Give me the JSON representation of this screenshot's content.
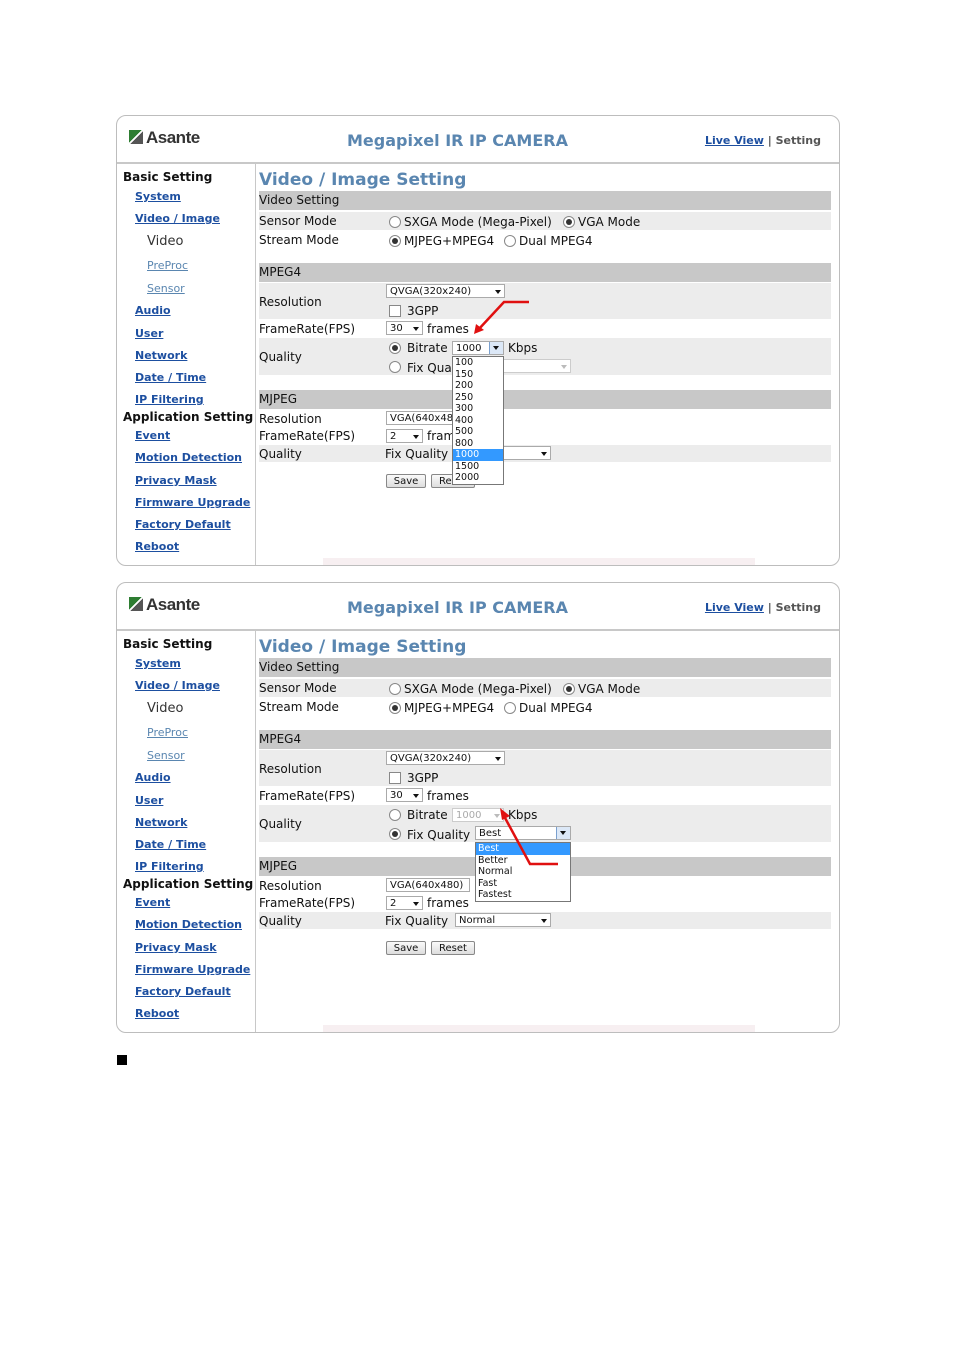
{
  "header": {
    "logo_text": "Asante",
    "camera_title": "Megapixel IR IP CAMERA",
    "live_view_link": "Live View",
    "separator": "|",
    "setting_label": "Setting"
  },
  "sidebar": {
    "basic_heading": "Basic Setting",
    "system": "System",
    "video_image": "Video / Image",
    "video": "Video",
    "preproc": "PreProc",
    "sensor": "Sensor",
    "audio": "Audio",
    "user": "User",
    "network": "Network",
    "date_time": "Date / Time",
    "ip_filtering": "IP Filtering",
    "app_heading": "Application Setting",
    "event": "Event",
    "motion_detection": "Motion Detection",
    "privacy_mask": "Privacy Mask",
    "firmware_upgrade": "Firmware Upgrade",
    "factory_default": "Factory Default",
    "reboot": "Reboot"
  },
  "page": {
    "title": "Video / Image Setting",
    "video_setting": "Video Setting",
    "sensor_mode_label": "Sensor Mode",
    "sensor_opt1": "SXGA Mode (Mega-Pixel)",
    "sensor_opt2": "VGA Mode",
    "stream_mode_label": "Stream Mode",
    "stream_opt1": "MJPEG+MPEG4",
    "stream_opt2": "Dual MPEG4",
    "mpeg4": "MPEG4",
    "resolution_label": "Resolution",
    "mpeg4_resolution": "QVGA(320x240)",
    "gpp_label": "3GPP",
    "framerate_label": "FrameRate(FPS)",
    "mpeg4_fps": "30",
    "frames": "frames",
    "quality_label": "Quality",
    "bitrate_label": "Bitrate",
    "bitrate_value": "1000",
    "kbps": "Kbps",
    "fix_quality_label": "Fix Quality",
    "mjpeg": "MJPEG",
    "mjpeg_resolution": "VGA(640x480)",
    "mjpeg_fps": "2",
    "save": "Save",
    "reset": "Reset"
  },
  "panel1": {
    "fix_quality_value": "",
    "mjpeg_quality_value": "",
    "bitrate_options": [
      "100",
      "150",
      "200",
      "250",
      "300",
      "400",
      "500",
      "800",
      "1000",
      "1500",
      "2000"
    ],
    "bitrate_selected": "1000"
  },
  "panel2": {
    "fix_quality_value": "Best",
    "mjpeg_quality_value": "Normal",
    "quality_options": [
      "Best",
      "Better",
      "Normal",
      "Fast",
      "Fastest"
    ],
    "quality_selected": "Best"
  },
  "colors": {
    "title_blue": "#5a86b0",
    "link_blue": "#1d4fa0",
    "bar_gray": "#c8c8c8",
    "highlight": "#3399ff",
    "annotation_red": "#e01010"
  }
}
